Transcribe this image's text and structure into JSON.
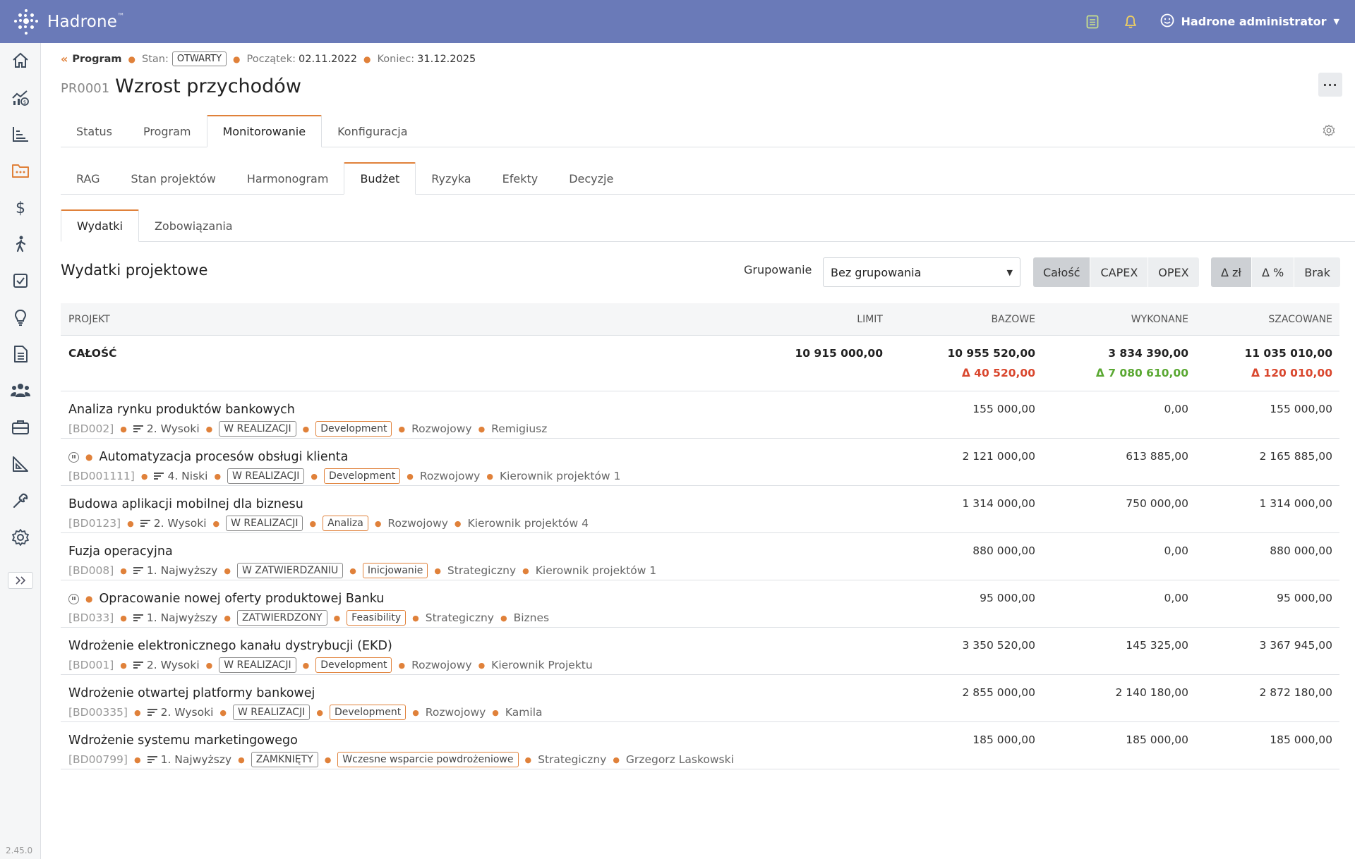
{
  "app": {
    "name": "Hadrone",
    "trademark": "™",
    "version": "2.45.0"
  },
  "user": {
    "name": "Hadrone administrator"
  },
  "icons": {
    "top": [
      "notes-icon",
      "bell-icon",
      "user-smile-icon"
    ],
    "sidebar": [
      "home-icon",
      "chart-growth-icon",
      "bar-chart-icon",
      "folder-icon",
      "dollar-icon",
      "person-walking-icon",
      "checkbox-icon",
      "lightbulb-icon",
      "document-icon",
      "users-icon",
      "briefcase-icon",
      "ruler-icon",
      "wrench-icon",
      "gear-icon"
    ]
  },
  "breadcrumb": {
    "program": "Program",
    "state_label": "Stan:",
    "state_value": "OTWARTY",
    "start_label": "Początek:",
    "start_value": "02.11.2022",
    "end_label": "Koniec:",
    "end_value": "31.12.2025"
  },
  "page": {
    "code": "PR0001",
    "title": "Wzrost przychodów",
    "more": "···"
  },
  "tabs_main": [
    "Status",
    "Program",
    "Monitorowanie",
    "Konfiguracja"
  ],
  "tabs_main_active": 2,
  "tabs_sub": [
    "RAG",
    "Stan projektów",
    "Harmonogram",
    "Budżet",
    "Ryzyka",
    "Efekty",
    "Decyzje"
  ],
  "tabs_sub_active": 3,
  "tabs_budget": [
    "Wydatki",
    "Zobowiązania"
  ],
  "tabs_budget_active": 0,
  "section": {
    "title": "Wydatki projektowe",
    "grouping_label": "Grupowanie",
    "grouping_value": "Bez grupowania",
    "scope_buttons": [
      "Całość",
      "CAPEX",
      "OPEX"
    ],
    "scope_active": 0,
    "delta_buttons": [
      "Δ zł",
      "Δ %",
      "Brak"
    ],
    "delta_active": 0
  },
  "table": {
    "headers": {
      "project": "PROJEKT",
      "limit": "LIMIT",
      "bazowe": "BAZOWE",
      "wykonane": "WYKONANE",
      "szacowane": "SZACOWANE"
    },
    "total": {
      "label": "CAŁOŚĆ",
      "limit": "10 915 000,00",
      "bazowe": "10 955 520,00",
      "wykonane": "3 834 390,00",
      "szacowane": "11 035 010,00",
      "delta_bazowe": "Δ 40 520,00",
      "delta_wykonane": "Δ 7 080 610,00",
      "delta_szacowane": "Δ 120 010,00",
      "colors": {
        "negative": "#d9472e",
        "positive": "#5aa832"
      }
    },
    "rows": [
      {
        "name": "Analiza rynku produktów bankowych",
        "paused": false,
        "code": "[BD002]",
        "priority": "2. Wysoki",
        "status": "W REALIZACJI",
        "phase": "Development",
        "type": "Rozwojowy",
        "manager": "Remigiusz",
        "bazowe": "155 000,00",
        "wykonane": "0,00",
        "szacowane": "155 000,00"
      },
      {
        "name": "Automatyzacja procesów obsługi klienta",
        "paused": true,
        "code": "[BD001111]",
        "priority": "4. Niski",
        "status": "W REALIZACJI",
        "phase": "Development",
        "type": "Rozwojowy",
        "manager": "Kierownik projektów 1",
        "bazowe": "2 121 000,00",
        "wykonane": "613 885,00",
        "szacowane": "2 165 885,00"
      },
      {
        "name": "Budowa aplikacji mobilnej dla biznesu",
        "paused": false,
        "code": "[BD0123]",
        "priority": "2. Wysoki",
        "status": "W REALIZACJI",
        "phase": "Analiza",
        "type": "Rozwojowy",
        "manager": "Kierownik projektów 4",
        "bazowe": "1 314 000,00",
        "wykonane": "750 000,00",
        "szacowane": "1 314 000,00"
      },
      {
        "name": "Fuzja operacyjna",
        "paused": false,
        "code": "[BD008]",
        "priority": "1. Najwyższy",
        "status": "W ZATWIERDZANIU",
        "phase": "Inicjowanie",
        "type": "Strategiczny",
        "manager": "Kierownik projektów 1",
        "bazowe": "880 000,00",
        "wykonane": "0,00",
        "szacowane": "880 000,00"
      },
      {
        "name": "Opracowanie nowej oferty produktowej Banku",
        "paused": true,
        "code": "[BD033]",
        "priority": "1. Najwyższy",
        "status": "ZATWIERDZONY",
        "phase": "Feasibility",
        "type": "Strategiczny",
        "manager": "Biznes",
        "bazowe": "95 000,00",
        "wykonane": "0,00",
        "szacowane": "95 000,00"
      },
      {
        "name": "Wdrożenie elektronicznego kanału dystrybucji (EKD)",
        "paused": false,
        "code": "[BD001]",
        "priority": "2. Wysoki",
        "status": "W REALIZACJI",
        "phase": "Development",
        "type": "Rozwojowy",
        "manager": "Kierownik Projektu",
        "bazowe": "3 350 520,00",
        "wykonane": "145 325,00",
        "szacowane": "3 367 945,00"
      },
      {
        "name": "Wdrożenie otwartej platformy bankowej",
        "paused": false,
        "code": "[BD00335]",
        "priority": "2. Wysoki",
        "status": "W REALIZACJI",
        "phase": "Development",
        "type": "Rozwojowy",
        "manager": "Kamila",
        "bazowe": "2 855 000,00",
        "wykonane": "2 140 180,00",
        "szacowane": "2 872 180,00"
      },
      {
        "name": "Wdrożenie systemu marketingowego",
        "paused": false,
        "code": "[BD00799]",
        "priority": "1. Najwyższy",
        "status": "ZAMKNIĘTY",
        "phase": "Wczesne wsparcie powdrożeniowe",
        "type": "Strategiczny",
        "manager": "Grzegorz Laskowski",
        "bazowe": "185 000,00",
        "wykonane": "185 000,00",
        "szacowane": "185 000,00"
      }
    ]
  }
}
